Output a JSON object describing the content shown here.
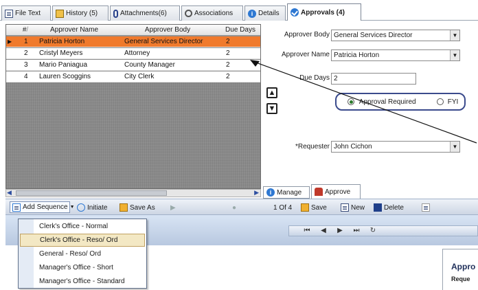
{
  "tabs": [
    {
      "label": "File Text",
      "icon": "document-icon"
    },
    {
      "label": "History (5)",
      "icon": "history-icon"
    },
    {
      "label": "Attachments(6)",
      "icon": "paperclip-icon"
    },
    {
      "label": "Associations",
      "icon": "associations-icon"
    },
    {
      "label": "Details",
      "icon": "info-icon"
    },
    {
      "label": "Approvals (4)",
      "icon": "checkmark-icon"
    }
  ],
  "grid": {
    "columns": [
      "#",
      "Approver Name",
      "Approver Body",
      "Due Days"
    ],
    "sort_marker": "/",
    "rows": [
      {
        "num": "1",
        "name": "Patricia Horton",
        "body": "General Services Director",
        "days": "2"
      },
      {
        "num": "2",
        "name": "Cristyl Meyers",
        "body": "Attorney",
        "days": "2"
      },
      {
        "num": "3",
        "name": "Mario Paniagua",
        "body": "County Manager",
        "days": "2"
      },
      {
        "num": "4",
        "name": "Lauren Scoggins",
        "body": "City Clerk",
        "days": "2"
      }
    ],
    "selected_index": 0
  },
  "detail": {
    "approver_body_label": "Approver Body",
    "approver_body_value": "General Services Director",
    "approver_name_label": "Approver Name",
    "approver_name_value": "Patricia Horton",
    "due_days_label": "Due Days",
    "due_days_value": "2",
    "radio_required": "Approval Required",
    "radio_fyi": "FYI",
    "requester_label": "Requester",
    "requester_required_mark": "*",
    "requester_value": "John Cichon"
  },
  "subtabs": [
    {
      "label": "Manage",
      "icon": "info-icon"
    },
    {
      "label": "Approve",
      "icon": "people-icon"
    }
  ],
  "toolbar": {
    "add_sequence": "Add Sequence",
    "initiate": "Initiate",
    "save_as": "Save As",
    "position": "1 Of 4",
    "save": "Save",
    "new": "New",
    "delete": "Delete"
  },
  "menu": {
    "items": [
      "Clerk's Office - Normal",
      "Clerk's Office - Reso/ Ord",
      "General - Reso/ Ord",
      "Manager's Office - Short",
      "Manager's Office - Standard"
    ],
    "highlighted_index": 1
  },
  "corner": {
    "title": "Appro",
    "sub": "Reque"
  },
  "colors": {
    "selected_row": "#f07a2c",
    "accent_blue": "#2e78d2"
  }
}
